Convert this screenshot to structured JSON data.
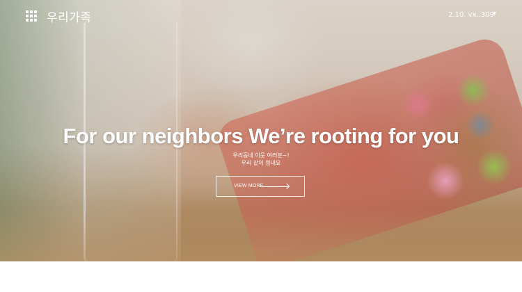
{
  "header": {
    "logo_text": "우리가족",
    "right_text": "2.10. vx..309",
    "menu_icon": "grid-menu-icon",
    "caret_icon": "caret-down-icon"
  },
  "hero": {
    "headline": "For our neighbors We’re rooting for you",
    "subline_1": "우리동네 이웃 여러분~!",
    "subline_2": "우리 같이 힘내요",
    "cta_label": "VIEW MORE",
    "cta_icon": "arrow-right-icon"
  },
  "colors": {
    "text": "#ffffff",
    "accent_paper": "#d8735f"
  }
}
